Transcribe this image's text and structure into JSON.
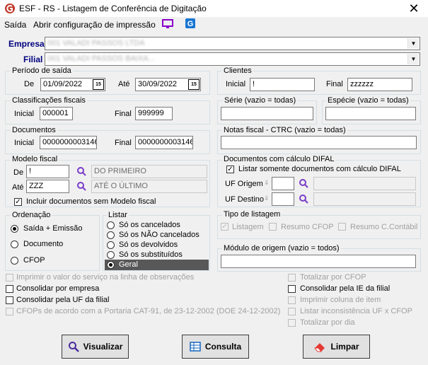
{
  "window": {
    "title": "ESF - RS - Listagem de Conferência de Digitação",
    "close": "✕"
  },
  "menu": {
    "exit": "Saída",
    "print_config": "Abrir configuração de impressão"
  },
  "empresa": {
    "label": "Empresa",
    "value": "001 VALADI PASSOS LTDA"
  },
  "filial": {
    "label": "Filial",
    "value": "001 VALADI PASSOS BAIXA..."
  },
  "periodo": {
    "legend": "Período de saída",
    "de_label": "De",
    "de_value": "01/09/2022",
    "ate_label": "Até",
    "ate_value": "30/09/2022",
    "cal": "15"
  },
  "clientes": {
    "legend": "Clientes",
    "inicial_label": "Inicial",
    "inicial_value": "!",
    "final_label": "Final",
    "final_value": "zzzzzz"
  },
  "classificacoes": {
    "legend": "Classificações fiscais",
    "inicial_label": "Inicial",
    "inicial_value": "000001",
    "final_label": "Final",
    "final_value": "999999"
  },
  "serie": {
    "legend": "Série (vazio = todas)",
    "value": ""
  },
  "especie": {
    "legend": "Espécie (vazio = todas)",
    "value": ""
  },
  "documentos": {
    "legend": "Documentos",
    "inicial_label": "Inicial",
    "inicial_value": "0000000003146",
    "final_label": "Final",
    "final_value": "0000000003146"
  },
  "notas": {
    "legend": "Notas fiscal - CTRC (vazio = todas)",
    "value": ""
  },
  "modelo": {
    "legend": "Modelo fiscal",
    "de_label": "De",
    "de_value": "!",
    "de_desc": "DO PRIMEIRO",
    "ate_label": "Até",
    "ate_value": "ZZZ",
    "ate_desc": "ATÉ O ÚLTIMO",
    "incluir": "Incluir documentos sem Modelo fiscal"
  },
  "difal": {
    "legend": "Documentos com cálculo DIFAL",
    "listar": "Listar somente documentos com cálculo DIFAL",
    "uf_origem_label": "UF Origem",
    "uf_destino_label": "UF Destino",
    "uf_origem": "",
    "uf_destino": ""
  },
  "ordenacao": {
    "legend": "Ordenação",
    "options": [
      "Saída + Emissão",
      "Documento",
      "CFOP"
    ]
  },
  "listar": {
    "legend": "Listar",
    "options": [
      "Só os cancelados",
      "Só os NÃO cancelados",
      "Só os devolvidos",
      "Só os substituídos",
      "Geral"
    ]
  },
  "tipo": {
    "legend": "Tipo de listagem",
    "listagem": "Listagem",
    "resumo_cfop": "Resumo  CFOP",
    "resumo_contabil": "Resumo C.Contábil"
  },
  "modulo": {
    "legend": "Módulo de origem (vazio = todos)",
    "value": ""
  },
  "options_left": [
    "Imprimir o valor do serviço na linha de observações",
    "Consolidar por empresa",
    "Consolidar pela UF da filial",
    "CFOPs de acordo com a Portaria CAT-91, de 23-12-2002 (DOE 24-12-2002)"
  ],
  "options_right": [
    "Totalizar por CFOP",
    "Consolidar pela IE da filial",
    "Imprimir coluna de item",
    "Listar inconsistência UF x CFOP",
    "Totalizar por dia"
  ],
  "buttons": {
    "visualizar": "Visualizar",
    "consulta": "Consulta",
    "limpar": "Limpar"
  },
  "colors": {
    "accent": "#00007f",
    "logo": "#c0392b"
  }
}
